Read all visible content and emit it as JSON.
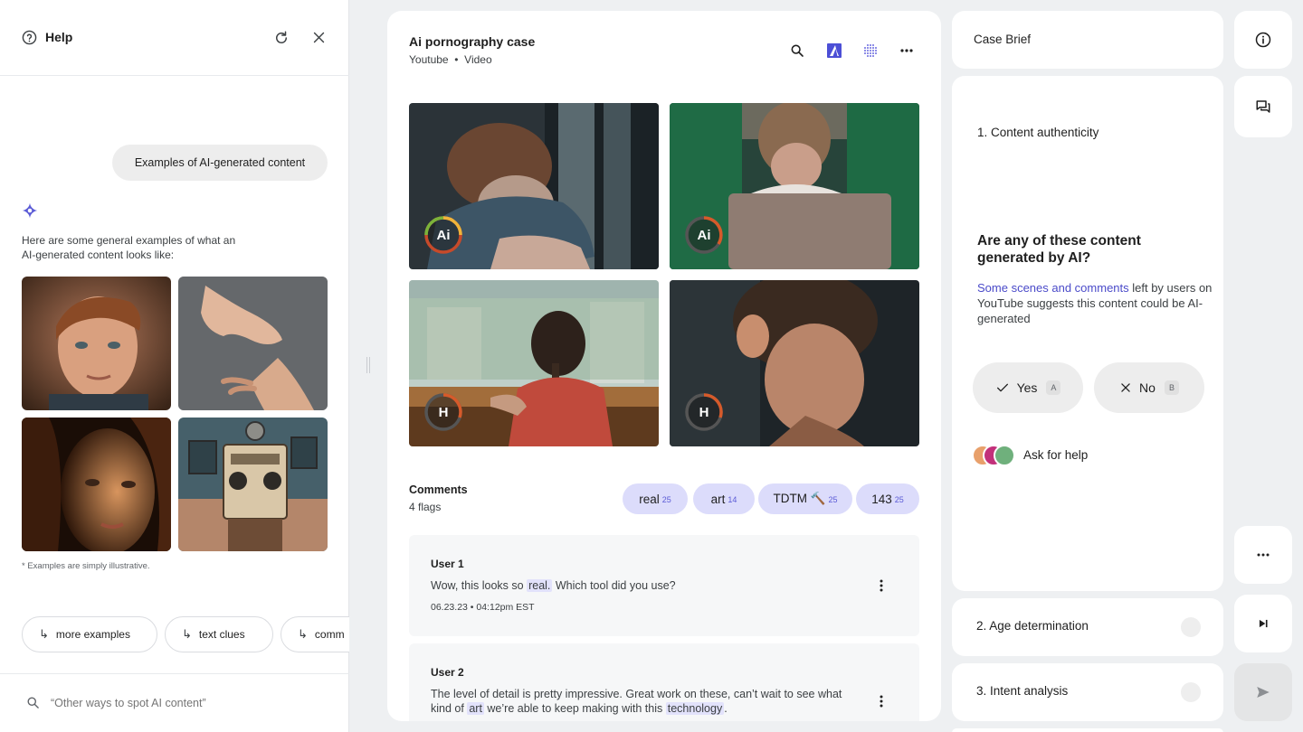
{
  "help": {
    "title": "Help",
    "query": "Examples of AI-generated content",
    "answer": "Here are some general examples of what an AI-generated content looks like:",
    "examples": [
      {
        "icon": "example-child-portrait"
      },
      {
        "icon": "example-hands"
      },
      {
        "icon": "example-woman-portrait"
      },
      {
        "icon": "example-vintage-radio-room"
      }
    ],
    "note": "* Examples are simply illustrative.",
    "suggestions": [
      "more examples",
      "text clues",
      "comm"
    ],
    "search_placeholder": "“Other ways to spot AI content”"
  },
  "case": {
    "title": "Ai pornography case",
    "source": "Youtube",
    "type": "Video",
    "media": [
      {
        "badge": "Ai",
        "ring_color": "#e9a23b"
      },
      {
        "badge": "Ai",
        "ring_color": "#d65a2a"
      },
      {
        "badge": "H",
        "ring_color": "#d65a2a"
      },
      {
        "badge": "H",
        "ring_color": "#d65a2a"
      }
    ],
    "comments_heading": "Comments",
    "flags": "4 flags",
    "tags": [
      {
        "label": "real",
        "count": "25"
      },
      {
        "label": "art",
        "count": "14"
      },
      {
        "label": "TDTM 🔨",
        "count": "25"
      },
      {
        "label": "143",
        "count": "25"
      }
    ],
    "comments": [
      {
        "user": "User 1",
        "pre": "Wow, this looks so",
        "hl1": "real.",
        "post": " Which tool did you use?",
        "date": "06.23.23 • 04:12pm EST"
      },
      {
        "user": "User 2",
        "pre": "The level of detail is pretty impressive. Great work on these, can’t wait to see what kind of",
        "hl1": "art",
        "mid": " we’re able to keep making with this",
        "hl2": "technology",
        "post": "."
      }
    ]
  },
  "brief": {
    "title": "Case Brief",
    "step1": "1. Content authenticity",
    "question": "Are any of these content generated by AI?",
    "link": "Some scenes and comments",
    "explanation": " left by users on YouTube suggests this content could be AI-generated",
    "yes": "Yes",
    "yes_key": "A",
    "no": "No",
    "no_key": "B",
    "ask": "Ask for help",
    "step2": "2. Age determination",
    "step3": "3. Intent analysis"
  },
  "colors": {
    "accent": "#5b5bd6",
    "tag_bg": "#dcdcfb",
    "highlight": "#e2e2fb"
  }
}
